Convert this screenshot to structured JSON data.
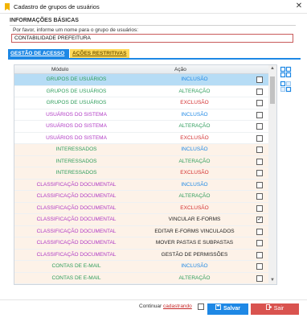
{
  "window": {
    "title": "Cadastro de grupos de usuários",
    "close_glyph": "✕",
    "icon": "window-icon"
  },
  "info": {
    "section_title": "INFORMAÇÕES BÁSICAS",
    "prompt": "Por favor, informe um nome para o grupo de usuários:",
    "group_name_value": "CONTABILIDADE PREFEITURA",
    "accent_color": "#c85a5a"
  },
  "tabs": [
    {
      "label": "GESTÃO DE ACESSO",
      "active": true,
      "color": "#1e88e5"
    },
    {
      "label": "AÇÕES RESTRITIVAS",
      "active": false,
      "color": "#ffd95a"
    }
  ],
  "grid": {
    "columns": [
      "Módulo",
      "Ação"
    ],
    "rows": [
      {
        "module": "GRUPOS DE USUÁRIOS",
        "action": "INCLUSÃO",
        "checked": false,
        "selected": true
      },
      {
        "module": "GRUPOS DE USUÁRIOS",
        "action": "ALTERAÇÃO",
        "checked": false
      },
      {
        "module": "GRUPOS DE USUÁRIOS",
        "action": "EXCLUSÃO",
        "checked": false
      },
      {
        "module": "USUÁRIOS DO SISTEMA",
        "action": "INCLUSÃO",
        "checked": false
      },
      {
        "module": "USUÁRIOS DO SISTEMA",
        "action": "ALTERAÇÃO",
        "checked": false
      },
      {
        "module": "USUÁRIOS DO SISTEMA",
        "action": "EXCLUSÃO",
        "checked": false
      },
      {
        "module": "INTERESSADOS",
        "action": "INCLUSÃO",
        "checked": false
      },
      {
        "module": "INTERESSADOS",
        "action": "ALTERAÇÃO",
        "checked": false
      },
      {
        "module": "INTERESSADOS",
        "action": "EXCLUSÃO",
        "checked": false
      },
      {
        "module": "CLASSIFICAÇÃO DOCUMENTAL",
        "action": "INCLUSÃO",
        "checked": false
      },
      {
        "module": "CLASSIFICAÇÃO DOCUMENTAL",
        "action": "ALTERAÇÃO",
        "checked": false
      },
      {
        "module": "CLASSIFICAÇÃO DOCUMENTAL",
        "action": "EXCLUSÃO",
        "checked": false
      },
      {
        "module": "CLASSIFICAÇÃO DOCUMENTAL",
        "action": "VINCULAR E-FORMS",
        "checked": true
      },
      {
        "module": "CLASSIFICAÇÃO DOCUMENTAL",
        "action": "EDITAR E-FORMS VINCULADOS",
        "checked": false
      },
      {
        "module": "CLASSIFICAÇÃO DOCUMENTAL",
        "action": "MOVER PASTAS E SUBPASTAS",
        "checked": false
      },
      {
        "module": "CLASSIFICAÇÃO DOCUMENTAL",
        "action": "GESTÃO DE PERMISSÕES",
        "checked": false
      },
      {
        "module": "CONTAS DE E-MAIL",
        "action": "INCLUSÃO",
        "checked": false
      },
      {
        "module": "CONTAS DE E-MAIL",
        "action": "ALTERAÇÃO",
        "checked": false
      }
    ],
    "check_glyph": "✓"
  },
  "colors": {
    "module": {
      "GRUPOS DE USUÁRIOS": "#2e9d5b",
      "USUÁRIOS DO SISTEMA": "#b03ac4",
      "INTERESSADOS": "#2e9d5b",
      "CLASSIFICAÇÃO DOCUMENTAL": "#b03ac4",
      "CONTAS DE E-MAIL": "#2e9d5b"
    },
    "action": {
      "INCLUSÃO": "#1e88e5",
      "ALTERAÇÃO": "#2e9d5b",
      "EXCLUSÃO": "#d32f2f",
      "OTHER": "#222222"
    },
    "row_tint": {
      "GRUPOS DE USUÁRIOS": "#ffffff",
      "USUÁRIOS DO SISTEMA": "#ffffff",
      "INTERESSADOS": "#fdf2e8",
      "CLASSIFICAÇÃO DOCUMENTAL": "#fdf2e8",
      "CONTAS DE E-MAIL": "#fdf2e8"
    }
  },
  "side_buttons": [
    {
      "icon": "expand-grid-icon"
    },
    {
      "icon": "collapse-grid-icon"
    }
  ],
  "footer": {
    "continuar_prefix": "Continuar",
    "continuar_link": "cadastrando",
    "continuar_checked": false,
    "save_label": "Salvar",
    "save_icon": "floppy-disk-icon",
    "exit_label": "Sair",
    "exit_icon": "exit-door-icon"
  }
}
